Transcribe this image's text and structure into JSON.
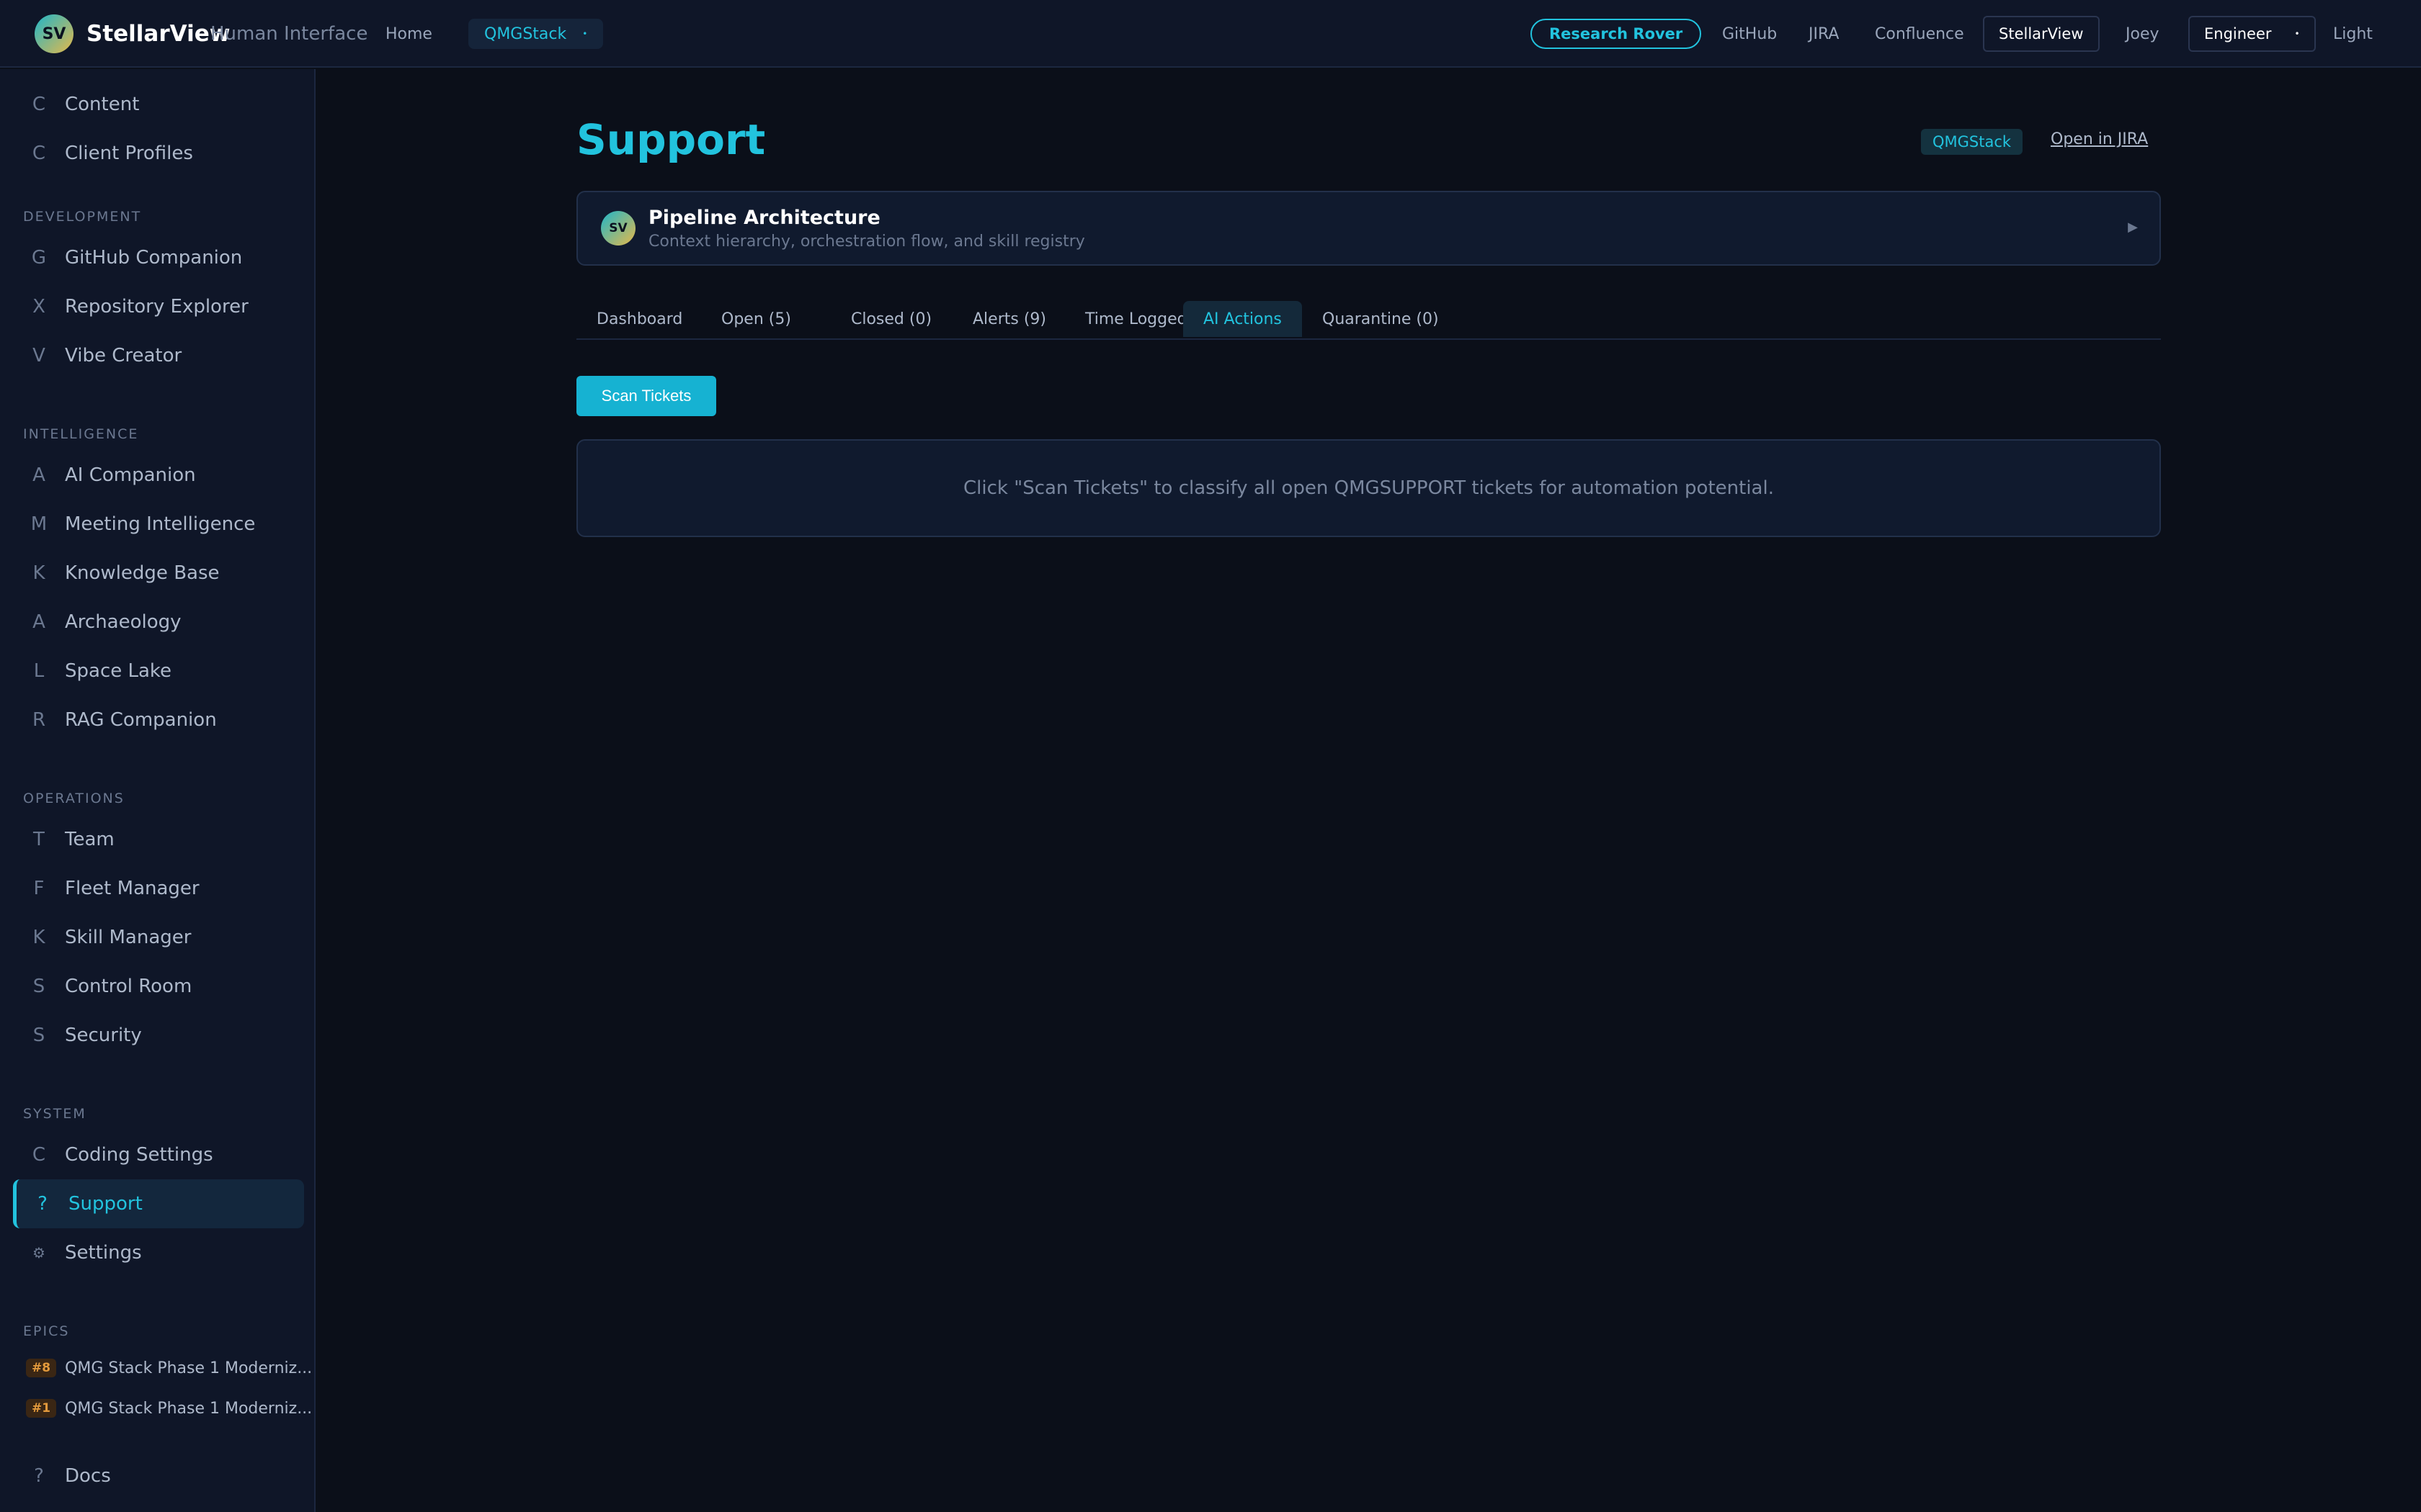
{
  "topbar": {
    "logo_initials": "SV",
    "brand": "StellarView",
    "brand_sub": "Human Interface",
    "home": "Home",
    "workspace": "QMGStack",
    "research_rover": "Research Rover",
    "links": [
      "GitHub",
      "JIRA",
      "Confluence"
    ],
    "active_app": "StellarView",
    "user": "Joey",
    "role": "Engineer",
    "theme": "Light"
  },
  "sidebar": {
    "top_items": [
      {
        "icon": "C",
        "label": "Content"
      },
      {
        "icon": "C",
        "label": "Client Profiles"
      }
    ],
    "sections": [
      {
        "heading": "DEVELOPMENT",
        "items": [
          {
            "icon": "G",
            "label": "GitHub Companion"
          },
          {
            "icon": "X",
            "label": "Repository Explorer"
          },
          {
            "icon": "V",
            "label": "Vibe Creator"
          }
        ]
      },
      {
        "heading": "INTELLIGENCE",
        "items": [
          {
            "icon": "A",
            "label": "AI Companion"
          },
          {
            "icon": "M",
            "label": "Meeting Intelligence"
          },
          {
            "icon": "K",
            "label": "Knowledge Base"
          },
          {
            "icon": "A",
            "label": "Archaeology"
          },
          {
            "icon": "L",
            "label": "Space Lake"
          },
          {
            "icon": "R",
            "label": "RAG Companion"
          }
        ]
      },
      {
        "heading": "OPERATIONS",
        "items": [
          {
            "icon": "T",
            "label": "Team"
          },
          {
            "icon": "F",
            "label": "Fleet Manager"
          },
          {
            "icon": "K",
            "label": "Skill Manager"
          },
          {
            "icon": "S",
            "label": "Control Room"
          },
          {
            "icon": "S",
            "label": "Security"
          }
        ]
      },
      {
        "heading": "SYSTEM",
        "items": [
          {
            "icon": "C",
            "label": "Coding Settings"
          },
          {
            "icon": "?",
            "label": "Support"
          },
          {
            "icon": "⚙",
            "label": "Settings"
          }
        ]
      }
    ],
    "epics_heading": "EPICS",
    "epics": [
      {
        "badge": "#8",
        "label": "QMG Stack Phase 1 Moderniz..."
      },
      {
        "badge": "#1",
        "label": "QMG Stack Phase 1 Moderniz..."
      }
    ],
    "docs": {
      "icon": "?",
      "label": "Docs"
    }
  },
  "main": {
    "title": "Support",
    "tag": "QMGStack",
    "open_in_jira": "Open in JIRA",
    "card": {
      "initials": "SV",
      "title": "Pipeline Architecture",
      "subtitle": "Context hierarchy, orchestration flow, and skill registry",
      "arrow": "▶"
    },
    "tabs": [
      "Dashboard",
      "Open (5)",
      "Closed (0)",
      "Alerts (9)",
      "Time Logged",
      "AI Actions",
      "Quarantine (0)"
    ],
    "active_tab": "AI Actions",
    "scan_button": "Scan Tickets",
    "empty_message": "Click \"Scan Tickets\" to classify all open QMGSUPPORT tickets for automation potential."
  },
  "colors": {
    "accent": "#22c3de",
    "background": "#0b0f19",
    "panel": "#0f1628",
    "epic_badge": "#e39a3c"
  }
}
